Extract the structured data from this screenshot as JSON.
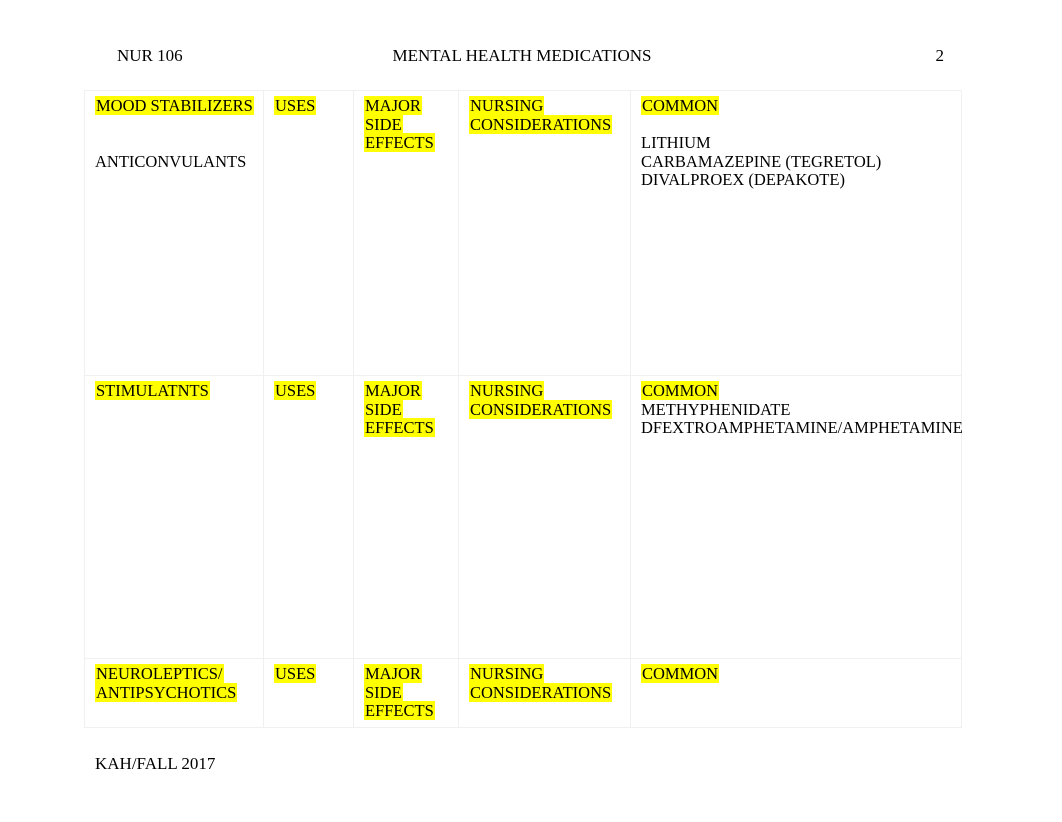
{
  "header": {
    "course": "NUR 106",
    "title": "MENTAL HEALTH MEDICATIONS",
    "page_number": "2"
  },
  "footer": {
    "text": "KAH/FALL 2017"
  },
  "colors": {
    "highlight": "#ffff00",
    "text": "#000000",
    "page_background": "#ffffff",
    "table_border": "#f0f0f0"
  },
  "table": {
    "columns": [
      {
        "key": "drug_class",
        "header": "MOOD STABILIZERS"
      },
      {
        "key": "uses",
        "header": "USES"
      },
      {
        "key": "side_effects",
        "header": "MAJOR SIDE EFFECTS"
      },
      {
        "key": "nursing",
        "header": "NURSING CONSIDERATIONS"
      },
      {
        "key": "common",
        "header": "COMMON"
      }
    ],
    "rows": [
      {
        "class_header": "MOOD STABILIZERS",
        "class_header_line2": "",
        "class_body": "ANTICONVULANTS",
        "uses_header": "USES",
        "effects_header_1": "MAJOR",
        "effects_header_2": "SIDE",
        "effects_header_3": "EFFECTS",
        "nursing_header_1": "NURSING",
        "nursing_header_2": "CONSIDERATIONS",
        "common_header": "COMMON",
        "common_items": [
          "LITHIUM",
          "CARBAMAZEPINE (TEGRETOL)",
          "DIVALPROEX (DEPAKOTE)"
        ]
      },
      {
        "class_header": "STIMULATNTS",
        "class_header_line2": "",
        "class_body": "",
        "uses_header": "USES",
        "effects_header_1": "MAJOR",
        "effects_header_2": "SIDE",
        "effects_header_3": "EFFECTS",
        "nursing_header_1": "NURSING",
        "nursing_header_2": "CONSIDERATIONS",
        "common_header": "COMMON",
        "common_items": [
          "METHYPHENIDATE",
          "DFEXTROAMPHETAMINE/AMPHETAMINE"
        ]
      },
      {
        "class_header": "NEUROLEPTICS/",
        "class_header_line2": "ANTIPSYCHOTICS",
        "class_body": "",
        "uses_header": "USES",
        "effects_header_1": "MAJOR",
        "effects_header_2": "SIDE",
        "effects_header_3": "EFFECTS",
        "nursing_header_1": "NURSING",
        "nursing_header_2": "CONSIDERATIONS",
        "common_header": "COMMON",
        "common_items": []
      }
    ]
  }
}
